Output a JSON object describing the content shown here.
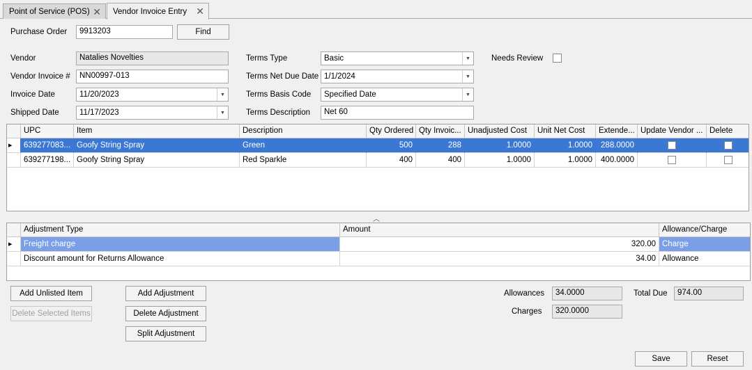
{
  "tabs": [
    {
      "label": "Point of Service (POS)",
      "close": "✕"
    },
    {
      "label": "Vendor Invoice Entry",
      "close": "✕"
    }
  ],
  "po": {
    "label": "Purchase Order",
    "value": "9913203",
    "find_label": "Find"
  },
  "vendor": {
    "label": "Vendor",
    "value": "Natalies Novelties"
  },
  "vendor_invoice": {
    "label": "Vendor Invoice #",
    "value": "NN00997-013"
  },
  "invoice_date": {
    "label": "Invoice Date",
    "value": "11/20/2023"
  },
  "shipped_date": {
    "label": "Shipped Date",
    "value": "11/17/2023"
  },
  "terms_type": {
    "label": "Terms Type",
    "value": "Basic"
  },
  "terms_net_due": {
    "label": "Terms Net Due Date",
    "value": "1/1/2024"
  },
  "terms_basis": {
    "label": "Terms Basis Code",
    "value": "Specified Date"
  },
  "terms_desc": {
    "label": "Terms Description",
    "value": "Net 60"
  },
  "needs_review": {
    "label": "Needs Review"
  },
  "items_grid": {
    "headers": [
      "UPC",
      "Item",
      "Description",
      "Qty Ordered",
      "Qty Invoic...",
      "Unadjusted Cost",
      "Unit Net Cost",
      "Extende...",
      "Update Vendor ...",
      "Delete"
    ],
    "rows": [
      {
        "upc": "639277083...",
        "item": "Goofy String Spray",
        "desc": "Green",
        "qty_ordered": "500",
        "qty_invoiced": "288",
        "unadj_cost": "1.0000",
        "unit_net_cost": "1.0000",
        "extended": "288.0000"
      },
      {
        "upc": "639277198...",
        "item": "Goofy String Spray",
        "desc": "Red Sparkle",
        "qty_ordered": "400",
        "qty_invoiced": "400",
        "unadj_cost": "1.0000",
        "unit_net_cost": "1.0000",
        "extended": "400.0000"
      }
    ]
  },
  "adj_grid": {
    "headers": [
      "Adjustment Type",
      "Amount",
      "Allowance/Charge"
    ],
    "rows": [
      {
        "type": "Freight charge",
        "amount": "320.00",
        "ac": "Charge"
      },
      {
        "type": "Discount amount for Returns Allowance",
        "amount": "34.00",
        "ac": "Allowance"
      }
    ]
  },
  "buttons": {
    "add_unlisted": "Add Unlisted Item",
    "delete_selected": "Delete Selected Items",
    "add_adjustment": "Add Adjustment",
    "delete_adjustment": "Delete Adjustment",
    "split_adjustment": "Split Adjustment",
    "save": "Save",
    "reset": "Reset"
  },
  "totals": {
    "allowances_label": "Allowances",
    "allowances": "34.0000",
    "charges_label": "Charges",
    "charges": "320.0000",
    "total_due_label": "Total Due",
    "total_due": "974.00"
  },
  "colors": {
    "selected_row": "#3a78d4",
    "selected_row_light": "#7a9fe6"
  }
}
